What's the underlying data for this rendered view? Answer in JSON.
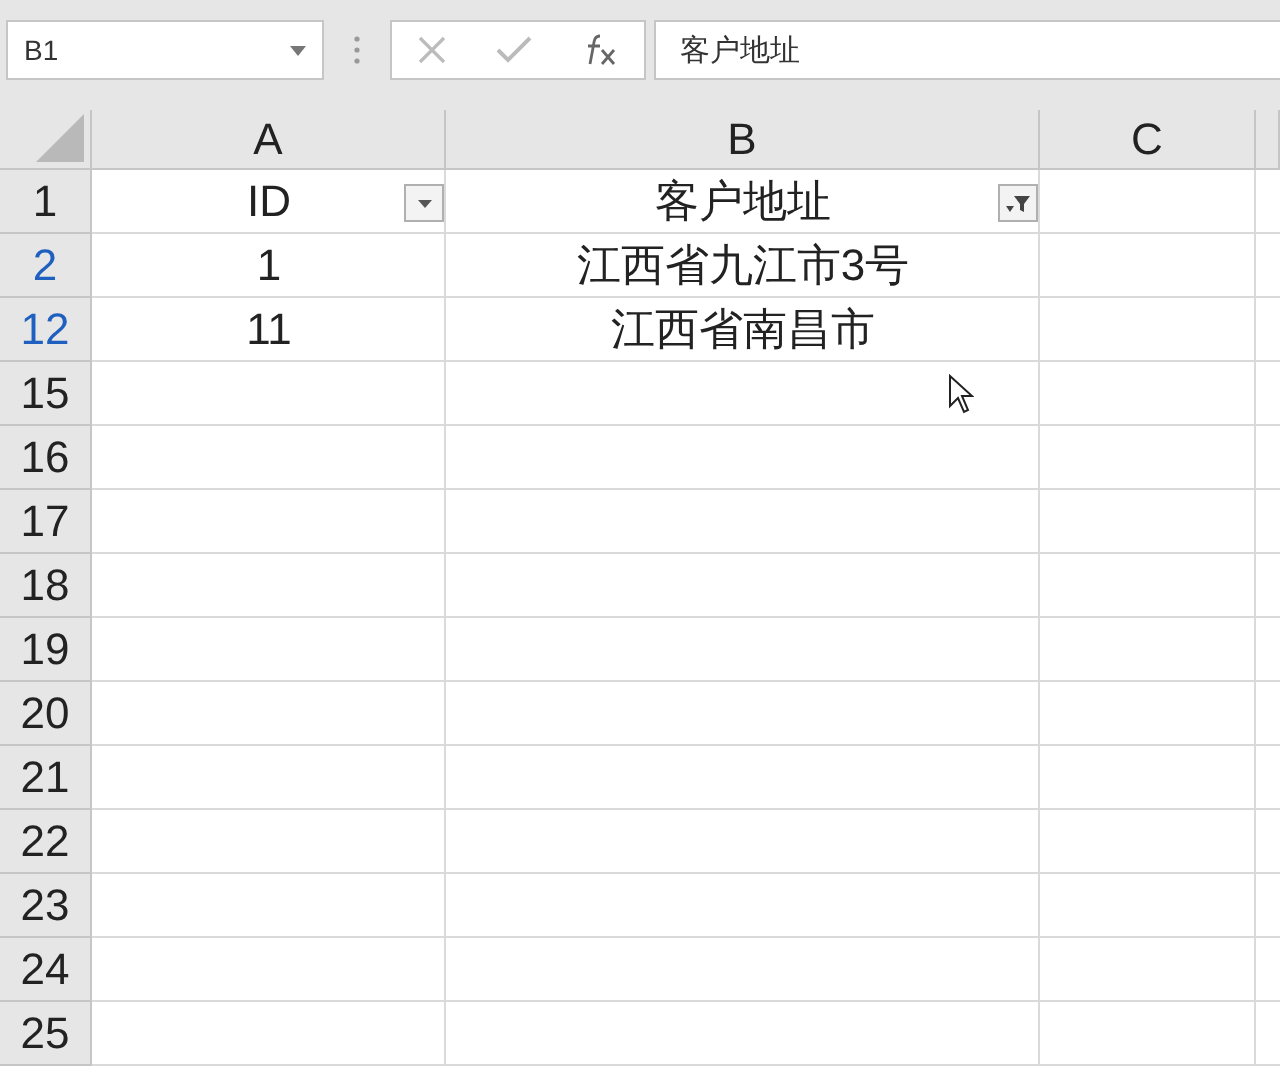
{
  "name_box": {
    "value": "B1"
  },
  "formula_bar": {
    "value": "客户地址"
  },
  "columns": [
    {
      "label": "A"
    },
    {
      "label": "B"
    },
    {
      "label": "C"
    }
  ],
  "rows": [
    {
      "number": "1",
      "filtered": false,
      "cells": [
        {
          "text": "ID",
          "filter_applied": false
        },
        {
          "text": "客户地址",
          "filter_applied": true
        }
      ]
    },
    {
      "number": "2",
      "filtered": true,
      "cells": [
        {
          "text": "1"
        },
        {
          "text": "江西省九江市3号"
        }
      ]
    },
    {
      "number": "12",
      "filtered": true,
      "cells": [
        {
          "text": "11"
        },
        {
          "text": "江西省南昌市"
        }
      ]
    },
    {
      "number": "15",
      "filtered": false
    },
    {
      "number": "16",
      "filtered": false
    },
    {
      "number": "17",
      "filtered": false
    },
    {
      "number": "18",
      "filtered": false
    },
    {
      "number": "19",
      "filtered": false
    },
    {
      "number": "20",
      "filtered": false
    },
    {
      "number": "21",
      "filtered": false
    },
    {
      "number": "22",
      "filtered": false
    },
    {
      "number": "23",
      "filtered": false
    },
    {
      "number": "24",
      "filtered": false
    },
    {
      "number": "25",
      "filtered": false
    }
  ]
}
